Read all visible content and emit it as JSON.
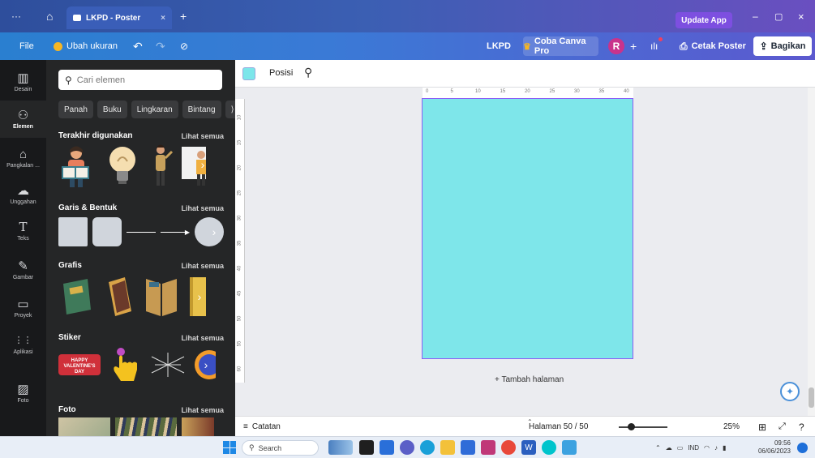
{
  "titlebar": {
    "menu_dots": "···",
    "tab_title": "LKPD - Poster",
    "tab_close": "×",
    "new_tab": "+",
    "update_app": "Update App",
    "minimize": "–",
    "maximize": "▢",
    "close": "×"
  },
  "toolbar": {
    "file": "File",
    "resize": "Ubah ukuran",
    "undo": "↶",
    "redo": "↷",
    "sync": "⊘",
    "doc_name": "LKPD",
    "try_pro": "Coba Canva Pro",
    "avatar_initial": "R",
    "add_people": "+",
    "print_poster": "Cetak Poster",
    "share": "Bagikan"
  },
  "rail": {
    "items": [
      {
        "label": "Desain",
        "icon": "▥"
      },
      {
        "label": "Elemen",
        "icon": "⚇"
      },
      {
        "label": "Pangkalan ...",
        "icon": "⌂"
      },
      {
        "label": "Unggahan",
        "icon": "☁"
      },
      {
        "label": "Teks",
        "icon": "T"
      },
      {
        "label": "Gambar",
        "icon": "✎"
      },
      {
        "label": "Proyek",
        "icon": "▭"
      },
      {
        "label": "Aplikasi",
        "icon": "⋮⋮"
      },
      {
        "label": "Foto",
        "icon": "▨"
      }
    ]
  },
  "panel": {
    "search_placeholder": "Cari elemen",
    "chips": [
      "Panah",
      "Buku",
      "Lingkaran",
      "Bintang",
      "⟩"
    ],
    "sections": [
      {
        "title": "Terakhir digunakan",
        "link": "Lihat semua"
      },
      {
        "title": "Garis & Bentuk",
        "link": "Lihat semua"
      },
      {
        "title": "Grafis",
        "link": "Lihat semua"
      },
      {
        "title": "Stiker",
        "link": "Lihat semua"
      },
      {
        "title": "Foto",
        "link": "Lihat semua"
      }
    ],
    "sticker_text": "HAPPY VALENTINE'S DAY"
  },
  "editor": {
    "swatch_color": "#7ee6ea",
    "position": "Posisi",
    "ruler_top": [
      "0",
      "5",
      "10",
      "15",
      "20",
      "25",
      "30",
      "35",
      "40"
    ],
    "ruler_left": [
      "10",
      "15",
      "20",
      "25",
      "30",
      "35",
      "40",
      "45",
      "50",
      "55",
      "60"
    ],
    "add_page": "+ Tambah halaman"
  },
  "status": {
    "notes": "Catatan",
    "page_indicator": "Halaman 50 / 50",
    "zoom": "25%",
    "zoom_level": 0.25
  },
  "taskbar": {
    "search": "Search",
    "lang": "IND",
    "time": "09:56",
    "date": "06/06/2023"
  }
}
